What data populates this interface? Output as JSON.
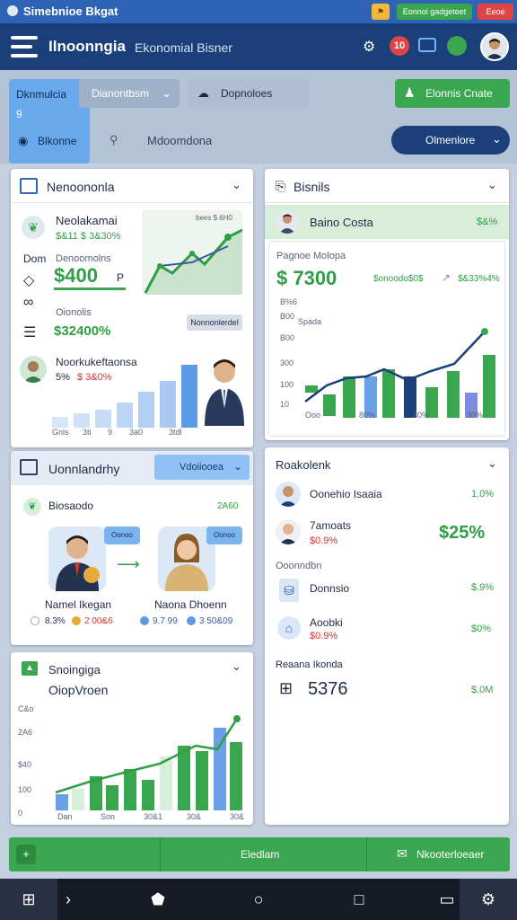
{
  "statusbar": {
    "title": "Simebnioe Bkgat",
    "pill1": "Eonnoi gadgeteet",
    "pill2": "Eeoe"
  },
  "header": {
    "app_name": "Ilnoonngia",
    "subtitle": "Ekonomial Bisner",
    "notif_count": "10"
  },
  "toolbar": {
    "tab_active": "Dknmulcia",
    "tab_active_sub": "9",
    "dropdown1": "Dianontbsm",
    "tab3": "Dopnoloes",
    "action_button": "Elonnis Cnate",
    "chip_active": "Blkonne",
    "chip2": "Mdoomdona",
    "right_button": "Olmenlore"
  },
  "card_overview": {
    "title": "Nenoononla",
    "row1_label": "Neolakamai",
    "row1_value": "$&11 $ 3&30%",
    "row2_label1": "Dom",
    "row2_label2": "Denoomolns",
    "big_value": "$400",
    "big_suffix": "P",
    "row4_label": "Oionolis",
    "row4_value": "$32400%",
    "side_button": "Nonnonlerdel",
    "mini_chart_label": "bees $ 6H0",
    "person_label": "Noorkukeftaonsa",
    "person_stats_a": "5%",
    "person_stats_b": "$ 3&0%",
    "axis_ticks": [
      "Gnis",
      "3ti",
      "9",
      "3a0",
      "3tdl"
    ]
  },
  "card_business": {
    "title": "Bisnils",
    "person_name": "Baino Costa",
    "person_value": "$&%",
    "sub_label": "Pagnoe Molopa",
    "big_value": "$ 7300",
    "sub_value": "$onoodo$0$",
    "trend_value": "$&33%4%",
    "y_ticks": [
      "B%6",
      "B00",
      "B00",
      "300",
      "100",
      "10"
    ],
    "y_title": "Spada",
    "x_ticks": [
      "Ooo",
      "80%",
      "30%",
      "30%"
    ]
  },
  "card_transfer": {
    "title": "Uonnlandrhy",
    "select": "Vdoiiooea",
    "sub_label": "Biosaodo",
    "sub_value": "2A60",
    "bubble1": "Oonoo",
    "bubble2": "Oonoo",
    "person1_name": "Namel Ikegan",
    "person2_name": "Naona Dhoenn",
    "p1_stat1": "8.3%",
    "p1_stat2": "2 00&6",
    "p2_stat1": "9.7 99",
    "p2_stat2": "3 50&09"
  },
  "card_rockolenk": {
    "title": "Roakolenk",
    "items": [
      {
        "name": "Oonehio Isaaia",
        "value": "1.0%",
        "sub": ""
      },
      {
        "name": "7amoats",
        "value": "$25%",
        "sub": "$0.9%"
      }
    ],
    "section_label": "Ooonndbn",
    "section_items": [
      {
        "name": "Donnsio",
        "value": "$.9%",
        "sub": ""
      },
      {
        "name": "Aoobki",
        "value": "$0%",
        "sub": "$0.9%"
      }
    ],
    "footer_label": "Reaana Ikonda",
    "footer_big": "5376",
    "footer_value": "$.0M"
  },
  "card_spending": {
    "title": "Snoingiga",
    "subtitle": "OiopVroen",
    "y_ticks": [
      "C&o",
      "2A6",
      "$40",
      "100",
      "0"
    ],
    "x_ticks": [
      "Dan",
      "Son",
      "30&1",
      "30&",
      "30&"
    ]
  },
  "footer_bar": {
    "center_label": "Eledlam",
    "right_label": "Nkooterloeaer"
  },
  "colors": {
    "primary_blue": "#1b3f79",
    "accent_green": "#3aa64f",
    "status_blue": "#2f63b6"
  }
}
